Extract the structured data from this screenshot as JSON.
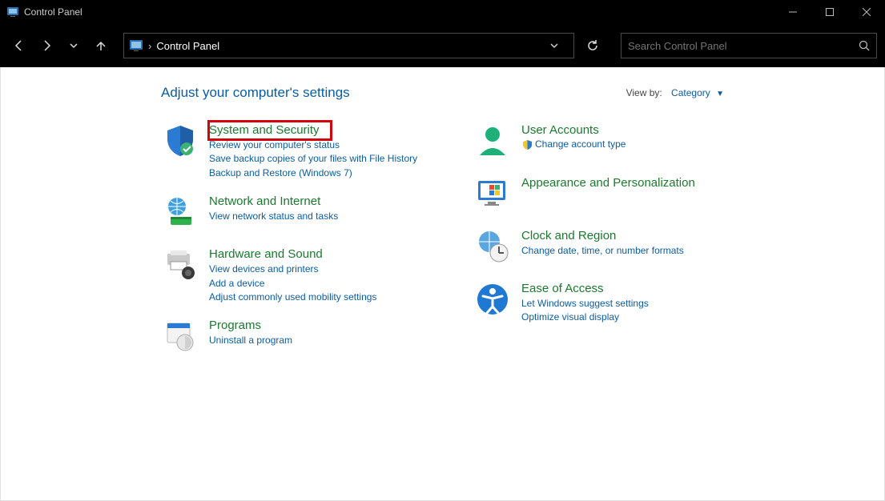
{
  "window": {
    "title": "Control Panel"
  },
  "address": {
    "breadcrumb": "Control Panel"
  },
  "search": {
    "placeholder": "Search Control Panel"
  },
  "header": {
    "heading": "Adjust your computer's settings",
    "viewby_label": "View by:",
    "viewby_value": "Category"
  },
  "cats": {
    "system_security": {
      "title": "System and Security",
      "links": [
        "Review your computer's status",
        "Save backup copies of your files with File History",
        "Backup and Restore (Windows 7)"
      ]
    },
    "network": {
      "title": "Network and Internet",
      "links": [
        "View network status and tasks"
      ]
    },
    "hardware": {
      "title": "Hardware and Sound",
      "links": [
        "View devices and printers",
        "Add a device",
        "Adjust commonly used mobility settings"
      ]
    },
    "programs": {
      "title": "Programs",
      "links": [
        "Uninstall a program"
      ]
    },
    "user_accounts": {
      "title": "User Accounts",
      "links": [
        "Change account type"
      ]
    },
    "appearance": {
      "title": "Appearance and Personalization"
    },
    "clock": {
      "title": "Clock and Region",
      "links": [
        "Change date, time, or number formats"
      ]
    },
    "ease": {
      "title": "Ease of Access",
      "links": [
        "Let Windows suggest settings",
        "Optimize visual display"
      ]
    }
  },
  "highlight": {
    "target": "system-and-security-link"
  }
}
